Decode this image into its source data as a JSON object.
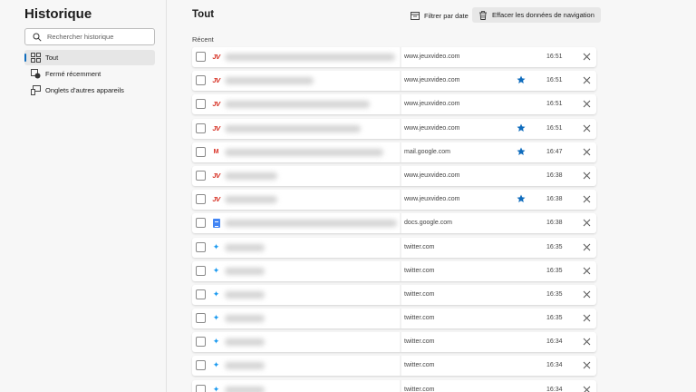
{
  "sidebar": {
    "title": "Historique",
    "search_placeholder": "Rechercher historique",
    "items": [
      {
        "label": "Tout",
        "icon": "grid-icon",
        "active": true
      },
      {
        "label": "Fermé récemment",
        "icon": "closed-tabs-icon",
        "active": false
      },
      {
        "label": "Onglets d'autres appareils",
        "icon": "devices-icon",
        "active": false
      }
    ]
  },
  "main": {
    "title": "Tout",
    "filter_label": "Filtrer par date",
    "clear_label": "Effacer les données de navigation",
    "section_label": "Récent"
  },
  "colors": {
    "accent": "#0f6cbd",
    "star": "#0f6cbd",
    "jv": "#d52b1e",
    "twitter": "#1d9bf0",
    "docs": "#4285f4",
    "gmail": "#d93025"
  },
  "rows": [
    {
      "favicon": "jv",
      "domain": "www.jeuxvideo.com",
      "time": "16:51",
      "starred": false
    },
    {
      "favicon": "jv",
      "domain": "www.jeuxvideo.com",
      "time": "16:51",
      "starred": true
    },
    {
      "favicon": "jv",
      "domain": "www.jeuxvideo.com",
      "time": "16:51",
      "starred": false
    },
    {
      "favicon": "jv",
      "domain": "www.jeuxvideo.com",
      "time": "16:51",
      "starred": true
    },
    {
      "favicon": "gmail",
      "domain": "mail.google.com",
      "time": "16:47",
      "starred": true
    },
    {
      "favicon": "jv",
      "domain": "www.jeuxvideo.com",
      "time": "16:38",
      "starred": false
    },
    {
      "favicon": "jv",
      "domain": "www.jeuxvideo.com",
      "time": "16:38",
      "starred": true
    },
    {
      "favicon": "docs",
      "domain": "docs.google.com",
      "time": "16:38",
      "starred": false
    },
    {
      "favicon": "twitter",
      "domain": "twitter.com",
      "time": "16:35",
      "starred": false
    },
    {
      "favicon": "twitter",
      "domain": "twitter.com",
      "time": "16:35",
      "starred": false
    },
    {
      "favicon": "twitter",
      "domain": "twitter.com",
      "time": "16:35",
      "starred": false
    },
    {
      "favicon": "twitter",
      "domain": "twitter.com",
      "time": "16:35",
      "starred": false
    },
    {
      "favicon": "twitter",
      "domain": "twitter.com",
      "time": "16:34",
      "starred": false
    },
    {
      "favicon": "twitter",
      "domain": "twitter.com",
      "time": "16:34",
      "starred": false
    },
    {
      "favicon": "twitter",
      "domain": "twitter.com",
      "time": "16:34",
      "starred": false
    }
  ]
}
